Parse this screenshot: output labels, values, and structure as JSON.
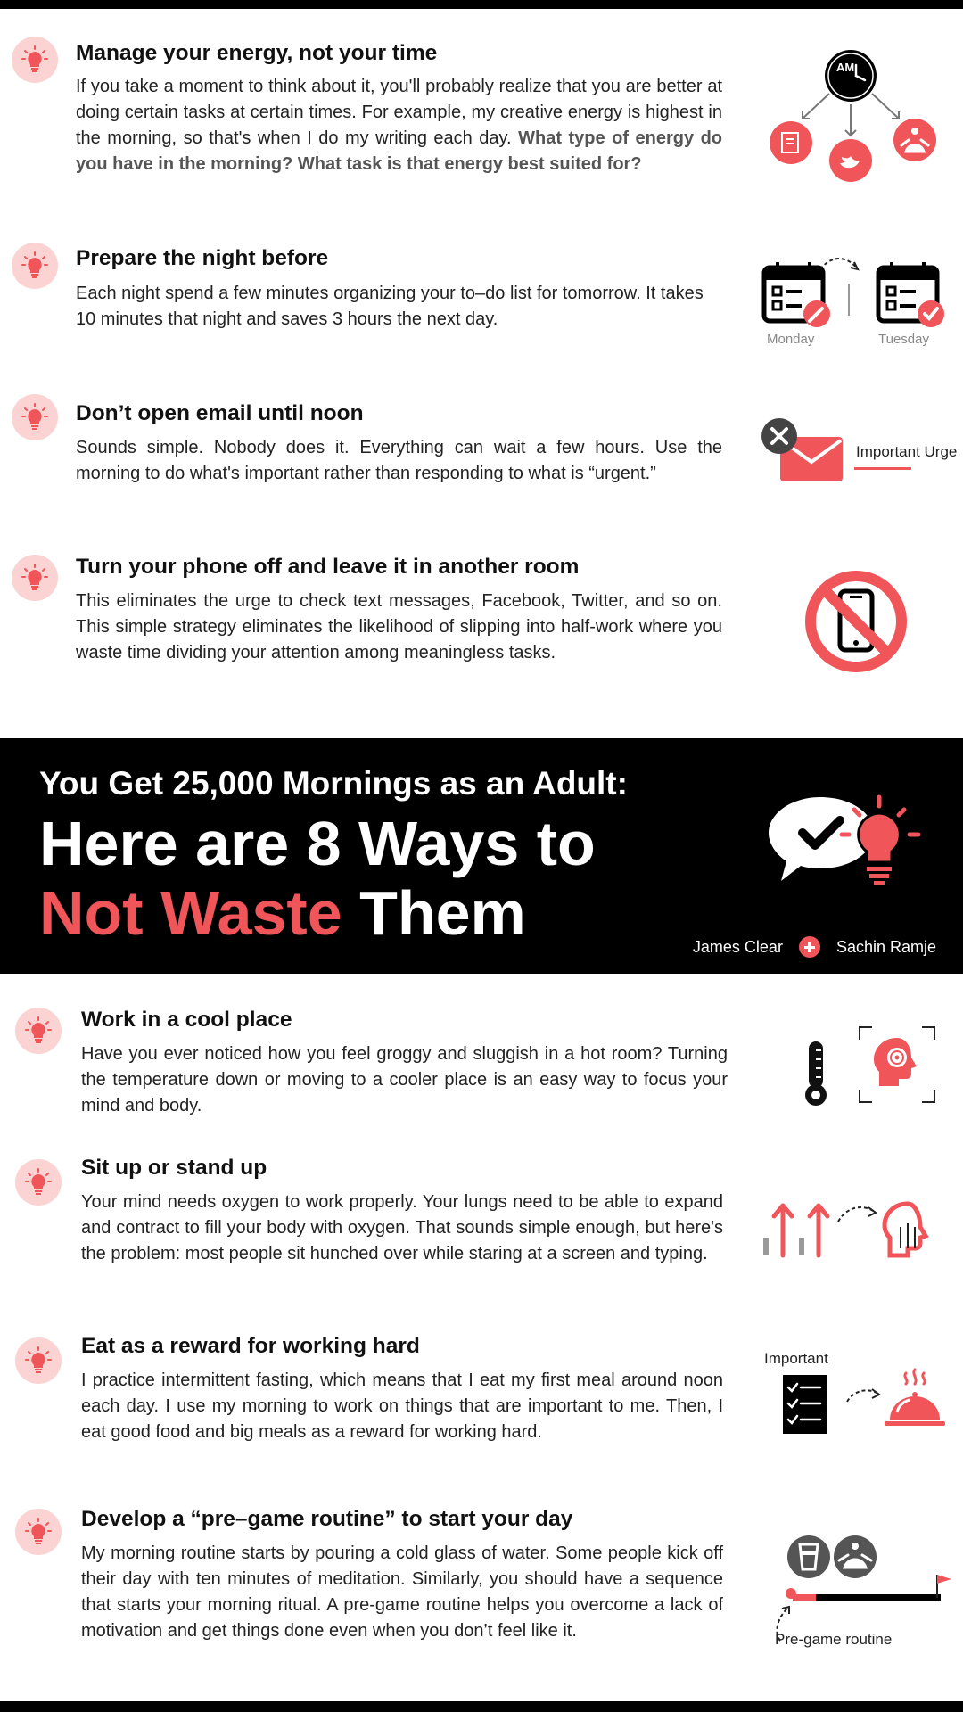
{
  "colors": {
    "accent": "#f0555a",
    "badge": "#fbd3d3",
    "dark": "#000000"
  },
  "banner": {
    "subtitle": "You Get 25,000 Mornings as an Adult:",
    "headline_line1": "Here are 8 Ways to",
    "headline_red": "Not Waste",
    "headline_white": "Them",
    "author_1": "James Clear",
    "author_2": "Sachin Ramje"
  },
  "tips": [
    {
      "title": "Manage your energy, not your time",
      "body": "If you take a moment to think about it, you'll probably realize that you are better at doing certain tasks at certain times. For example, my creative energy is highest in the morning, so that's when I do my writing each day.",
      "highlight": "What type of energy do you have in the morning? What task is that energy best suited for?",
      "icon": "am-clock-branches-icon",
      "clock_label": "AM"
    },
    {
      "title": "Prepare the night before",
      "body": "Each night spend a few minutes organizing your to–do list for tomorrow. It takes 10 minutes that night and saves 3 hours the next day.",
      "icon": "calendar-pair-icon",
      "caption_left": "Monday",
      "caption_right": "Tuesday"
    },
    {
      "title": "Don’t open email until noon",
      "body": "Sounds simple. Nobody does it. Everything can wait a few hours. Use the morning to do what's important rather than responding to what is “urgent.”",
      "icon": "no-email-icon",
      "caption": "Important Urge"
    },
    {
      "title": "Turn your phone off and leave it in another room",
      "body": "This eliminates the urge to check text messages, Facebook, Twitter, and so on. This simple strategy eliminates the likelihood of slipping into half-work where you waste time dividing your attention among meaningless tasks.",
      "icon": "no-phone-icon"
    },
    {
      "title": "Work in a cool place",
      "body": "Have you ever noticed how you feel groggy and sluggish in a hot room? Turning the temperature down or moving to a cooler place is an easy way to focus your mind and body.",
      "icon": "thermometer-focus-icon"
    },
    {
      "title": "Sit up or stand up",
      "body": "Your mind needs oxygen to work properly. Your lungs need to be able to expand and contract to fill your body with oxygen. That sounds simple enough, but here's the problem: most people sit hunched over while staring at a screen and typing.",
      "icon": "posture-arrows-icon"
    },
    {
      "title": "Eat as a reward for working hard",
      "body": "I practice intermittent fasting, which means that I eat my first meal around noon each day. I use my morning to work on things that are important to me. Then, I eat good food and big meals as a reward for working hard.",
      "icon": "checklist-meal-icon",
      "caption": "Important"
    },
    {
      "title": "Develop a “pre–game routine” to start your day",
      "body": "My morning routine starts by pouring a cold glass of water. Some people kick off their day with ten minutes of meditation. Similarly, you should have a sequence that starts your morning ritual. A pre-game routine helps you overcome a lack of motivation and get things done even when you don’t feel like it.",
      "icon": "routine-timeline-icon",
      "caption": "Pre-game routine"
    }
  ]
}
